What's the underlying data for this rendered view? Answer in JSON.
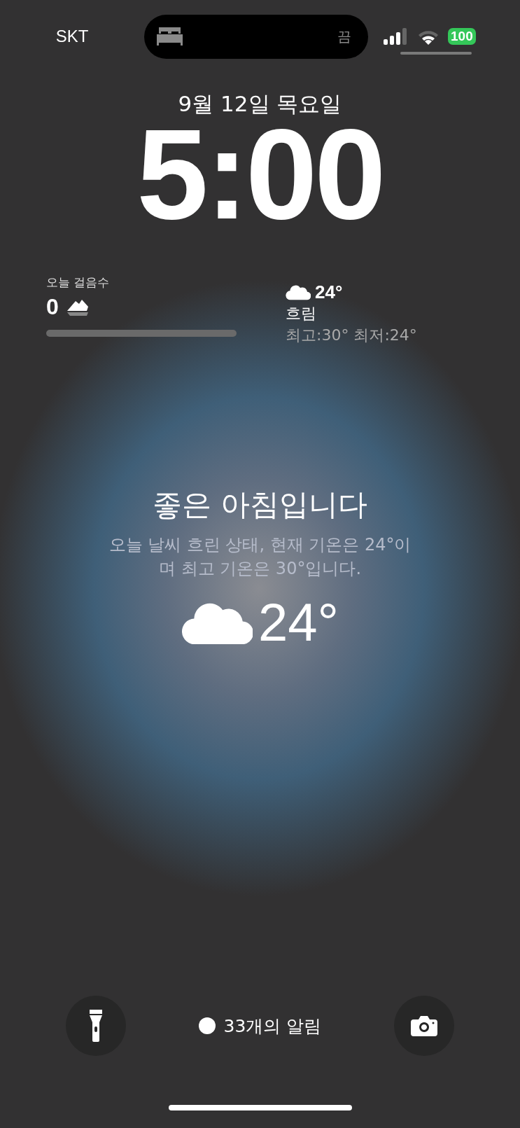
{
  "status_bar": {
    "carrier": "SKT",
    "island_status": "끔",
    "battery": "100"
  },
  "clock": {
    "date": "9월 12일 목요일",
    "time": "5:00"
  },
  "steps_widget": {
    "title": "오늘 걸음수",
    "count": "0",
    "level": 0
  },
  "weather_widget": {
    "temperature": "24°",
    "condition": "흐림",
    "range": "최고:30° 최저:24°"
  },
  "greeting": {
    "title": "좋은 아침입니다",
    "summary": "오늘 날씨 흐린 상태, 현재 기온은 24°이며 최고 기온은 30°입니다.",
    "temperature": "24°"
  },
  "footer": {
    "notifications": "33개의 알림"
  }
}
